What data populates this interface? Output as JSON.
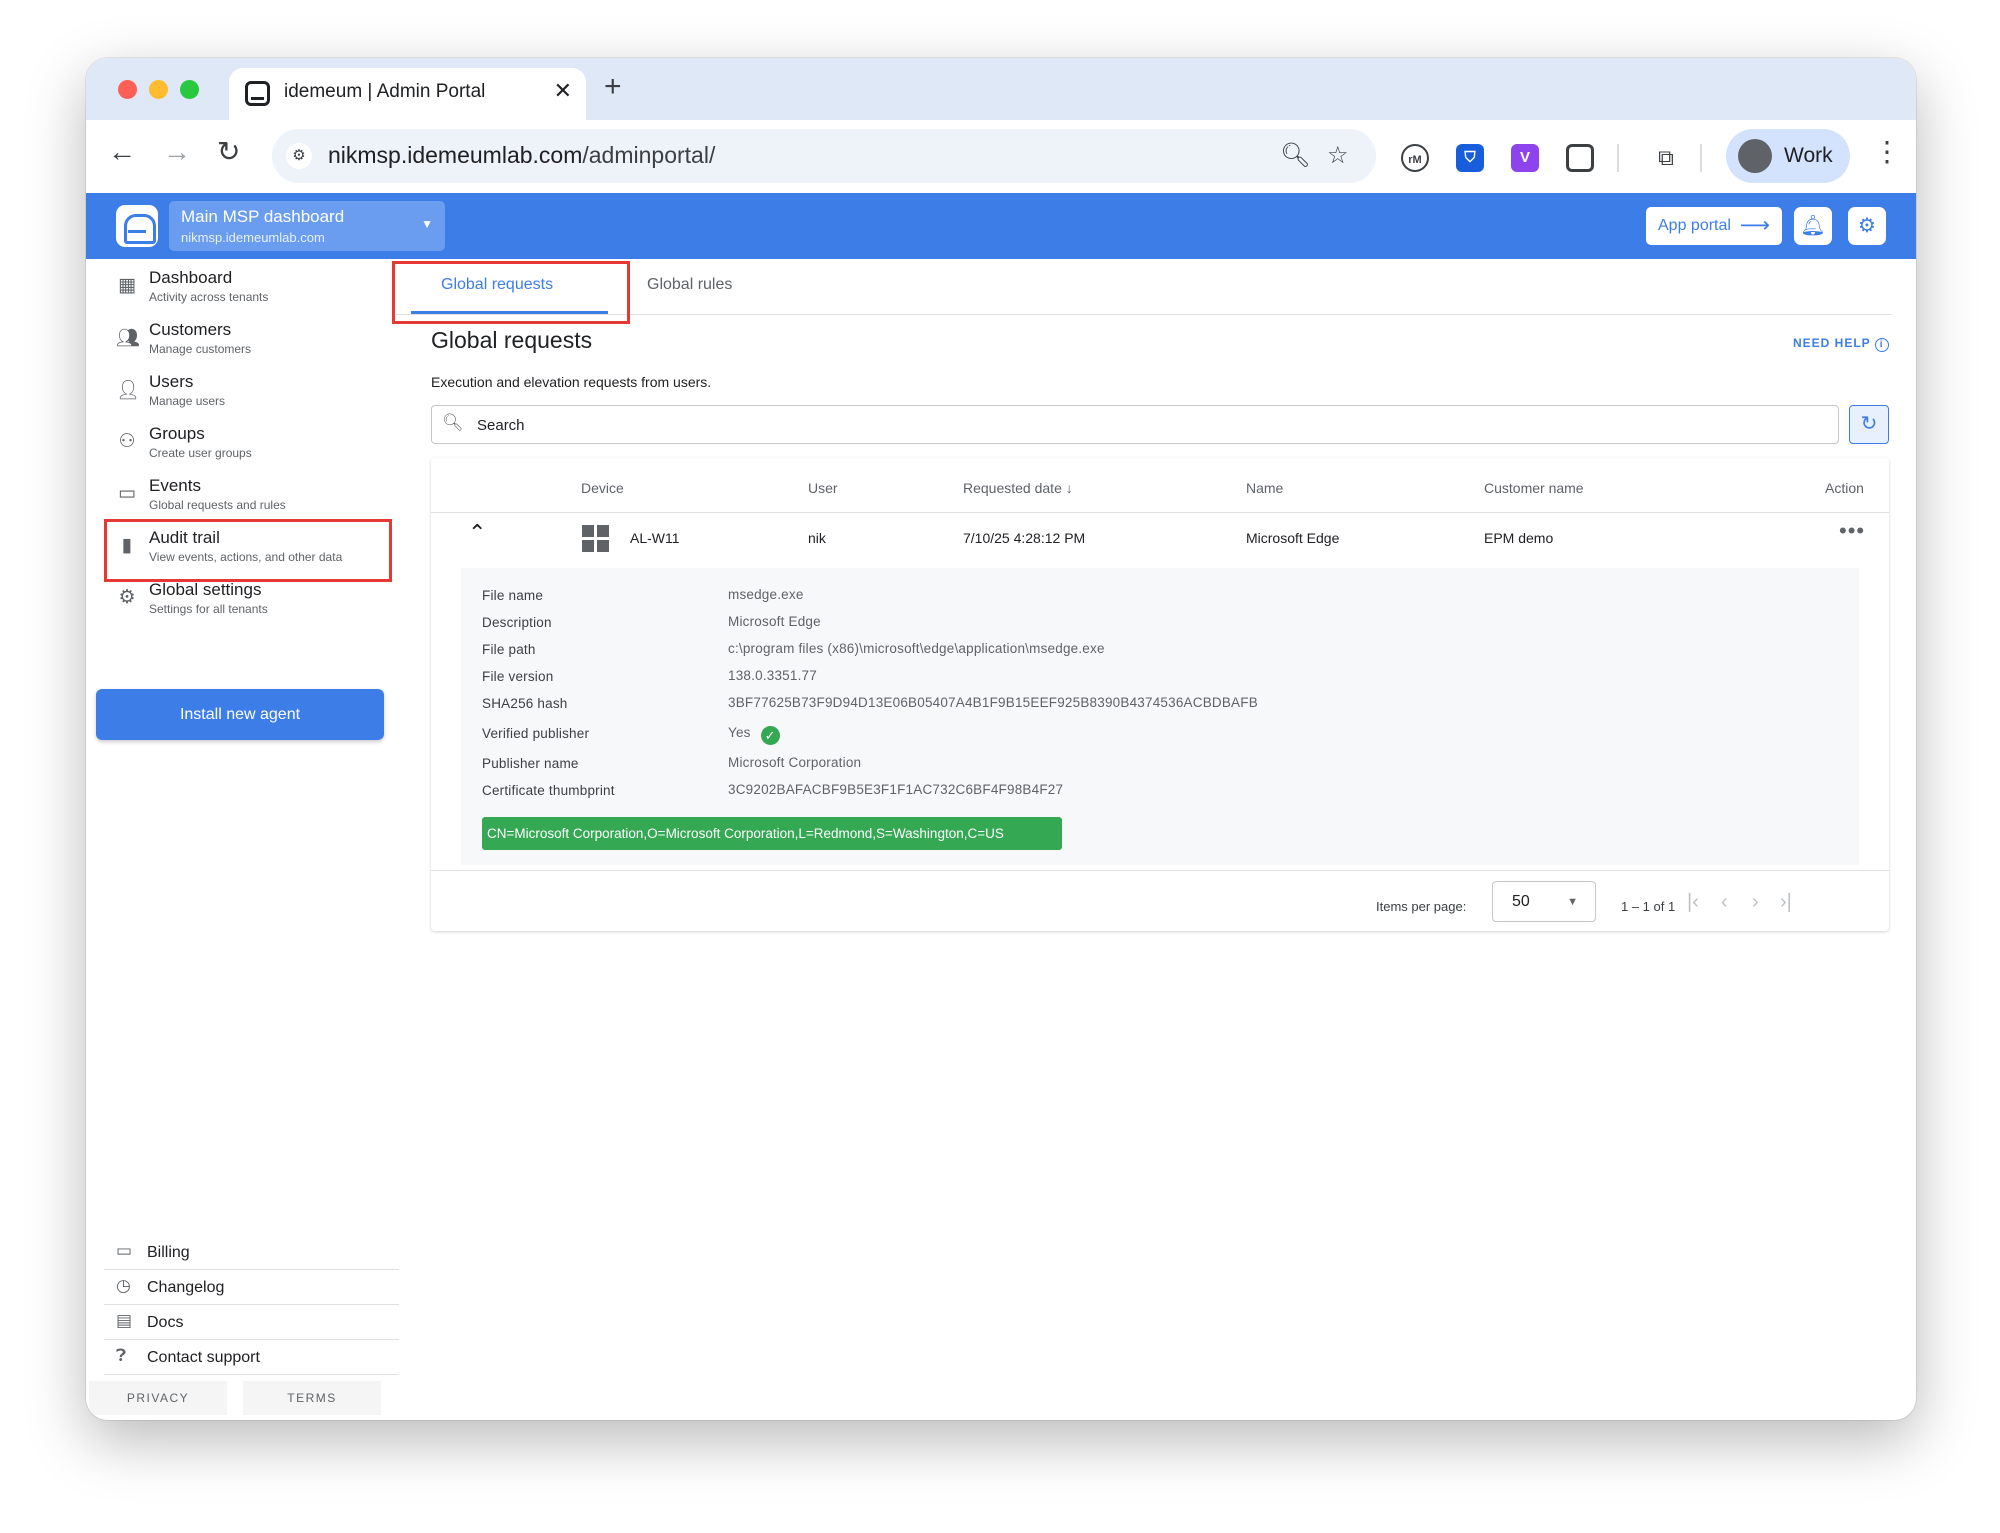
{
  "browser": {
    "tab_title": "idemeum | Admin Portal",
    "url_host": "nikmsp.idemeumlab.com",
    "url_path": "/adminportal/",
    "profile_name": "Work",
    "ext_rm": "rM",
    "ext_v": "V"
  },
  "header": {
    "tenant_title": "Main MSP dashboard",
    "tenant_sub": "nikmsp.idemeumlab.com",
    "app_portal": "App portal",
    "accent": "#3d7de8"
  },
  "sidebar": {
    "items": [
      {
        "title": "Dashboard",
        "sub": "Activity across tenants",
        "icon": "dashboard-icon"
      },
      {
        "title": "Customers",
        "sub": "Manage customers",
        "icon": "customers-icon"
      },
      {
        "title": "Users",
        "sub": "Manage users",
        "icon": "user-icon"
      },
      {
        "title": "Groups",
        "sub": "Create user groups",
        "icon": "groups-icon"
      },
      {
        "title": "Events",
        "sub": "Global requests and rules",
        "icon": "devices-icon"
      },
      {
        "title": "Audit trail",
        "sub": "View events, actions, and other data",
        "icon": "bar-chart-icon"
      },
      {
        "title": "Global settings",
        "sub": "Settings for all tenants",
        "icon": "gear-icon"
      }
    ],
    "install_button": "Install new agent",
    "bottom_links": [
      {
        "label": "Billing",
        "icon": "billing-icon"
      },
      {
        "label": "Changelog",
        "icon": "history-icon"
      },
      {
        "label": "Docs",
        "icon": "doc-icon"
      },
      {
        "label": "Contact support",
        "icon": "help-icon"
      }
    ],
    "privacy": "PRIVACY",
    "terms": "TERMS"
  },
  "main": {
    "tabs": [
      {
        "label": "Global requests",
        "active": true
      },
      {
        "label": "Global rules",
        "active": false
      }
    ],
    "title": "Global requests",
    "need_help": "NEED HELP",
    "description": "Execution and elevation requests from users.",
    "search_placeholder": "Search",
    "table": {
      "columns": [
        "Device",
        "User",
        "Requested date",
        "Name",
        "Customer name",
        "Action"
      ],
      "row": {
        "device": "AL-W11",
        "user": "nik",
        "requested_date": "7/10/25 4:28:12 PM",
        "name": "Microsoft Edge",
        "customer": "EPM demo"
      },
      "details": [
        {
          "label": "File name",
          "value": "msedge.exe"
        },
        {
          "label": "Description",
          "value": "Microsoft Edge"
        },
        {
          "label": "File path",
          "value": "c:\\program files (x86)\\microsoft\\edge\\application\\msedge.exe"
        },
        {
          "label": "File version",
          "value": "138.0.3351.77"
        },
        {
          "label": "SHA256 hash",
          "value": "3BF77625B73F9D94D13E06B05407A4B1F9B15EEF925B8390B4374536ACBDBAFB"
        },
        {
          "label": "Verified publisher",
          "value": "Yes"
        },
        {
          "label": "Publisher name",
          "value": "Microsoft Corporation"
        },
        {
          "label": "Certificate thumbprint",
          "value": "3C9202BAFACBF9B5E3F1F1AC732C6BF4F98B4F27"
        }
      ],
      "certificate_subject": "CN=Microsoft Corporation,O=Microsoft Corporation,L=Redmond,S=Washington,C=US"
    },
    "paginator": {
      "items_per_page_label": "Items per page:",
      "items_per_page": "50",
      "range": "1 – 1 of 1"
    }
  }
}
